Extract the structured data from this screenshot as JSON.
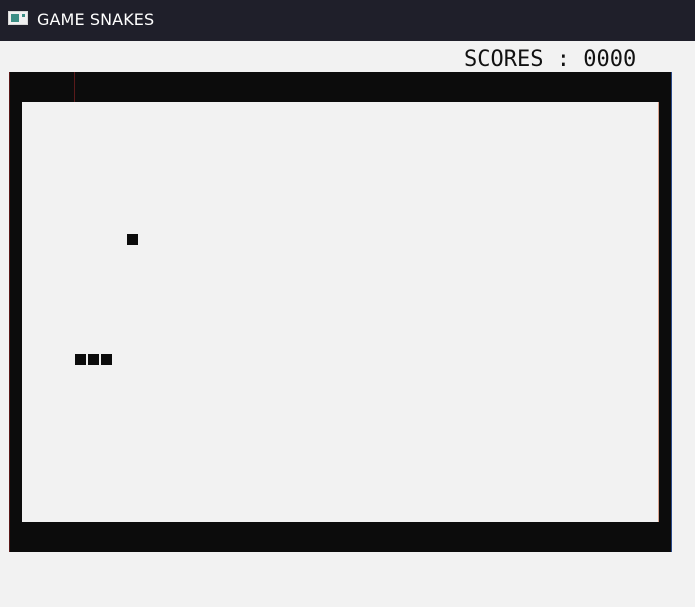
{
  "window": {
    "title": "GAME SNAKES",
    "icon": "window-app-icon"
  },
  "hud": {
    "score_text": "SCORES : 0000",
    "score_label": "SCORES",
    "score_value": "0000"
  },
  "game": {
    "snake_length": 3,
    "food_count": 1,
    "board_color": "#0c0c0c",
    "field_color": "#f2f2f2"
  }
}
